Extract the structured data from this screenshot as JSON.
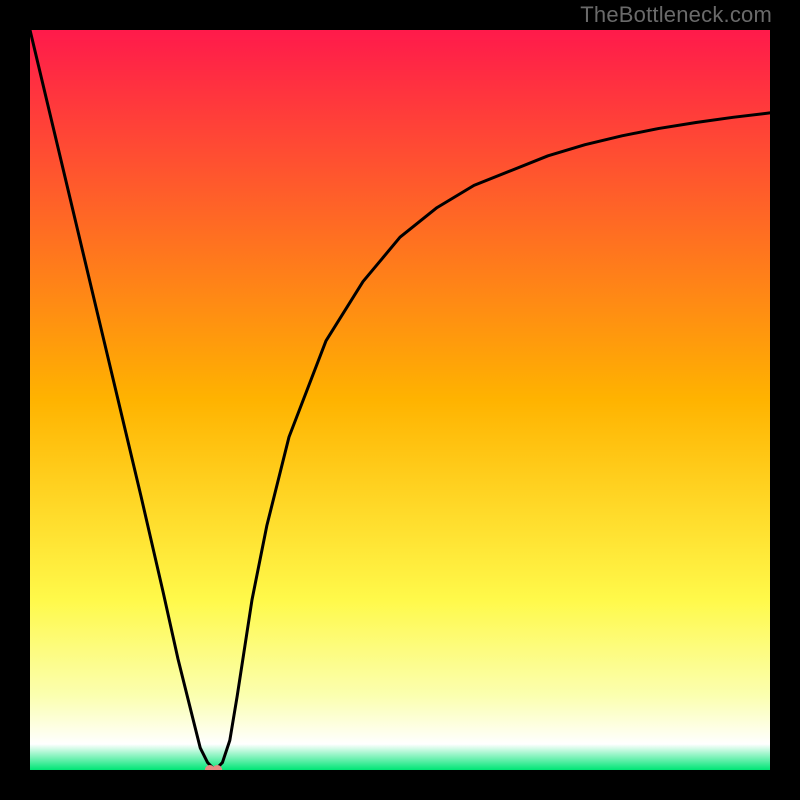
{
  "watermark": {
    "text": "TheBottleneck.com"
  },
  "chart_data": {
    "type": "line",
    "title": "",
    "xlabel": "",
    "ylabel": "",
    "xlim": [
      0,
      100
    ],
    "ylim": [
      0,
      100
    ],
    "grid": false,
    "legend": false,
    "background_gradient": {
      "stops": [
        {
          "offset": 0.0,
          "color": "#ff1a4b"
        },
        {
          "offset": 0.5,
          "color": "#ffb300"
        },
        {
          "offset": 0.77,
          "color": "#fff94a"
        },
        {
          "offset": 0.9,
          "color": "#fbffb0"
        },
        {
          "offset": 0.965,
          "color": "#ffffff"
        },
        {
          "offset": 1.0,
          "color": "#00e676"
        }
      ]
    },
    "series": [
      {
        "name": "curve",
        "color": "#000000",
        "x": [
          0,
          5,
          10,
          15,
          18,
          20,
          22,
          23,
          24,
          25,
          26,
          27,
          28,
          30,
          32,
          35,
          40,
          45,
          50,
          55,
          60,
          65,
          70,
          75,
          80,
          85,
          90,
          95,
          100
        ],
        "y": [
          100,
          79,
          58,
          37,
          24,
          15,
          7,
          3,
          1,
          0,
          1,
          4,
          10,
          23,
          33,
          45,
          58,
          66,
          72,
          76,
          79,
          81,
          83,
          84.5,
          85.7,
          86.7,
          87.5,
          88.2,
          88.8
        ]
      }
    ],
    "marker_cluster": {
      "color": "#e58b82",
      "points": [
        {
          "x": 24.3,
          "y": 0.0
        },
        {
          "x": 25.3,
          "y": 0.0
        }
      ],
      "radius_px": 5
    }
  }
}
